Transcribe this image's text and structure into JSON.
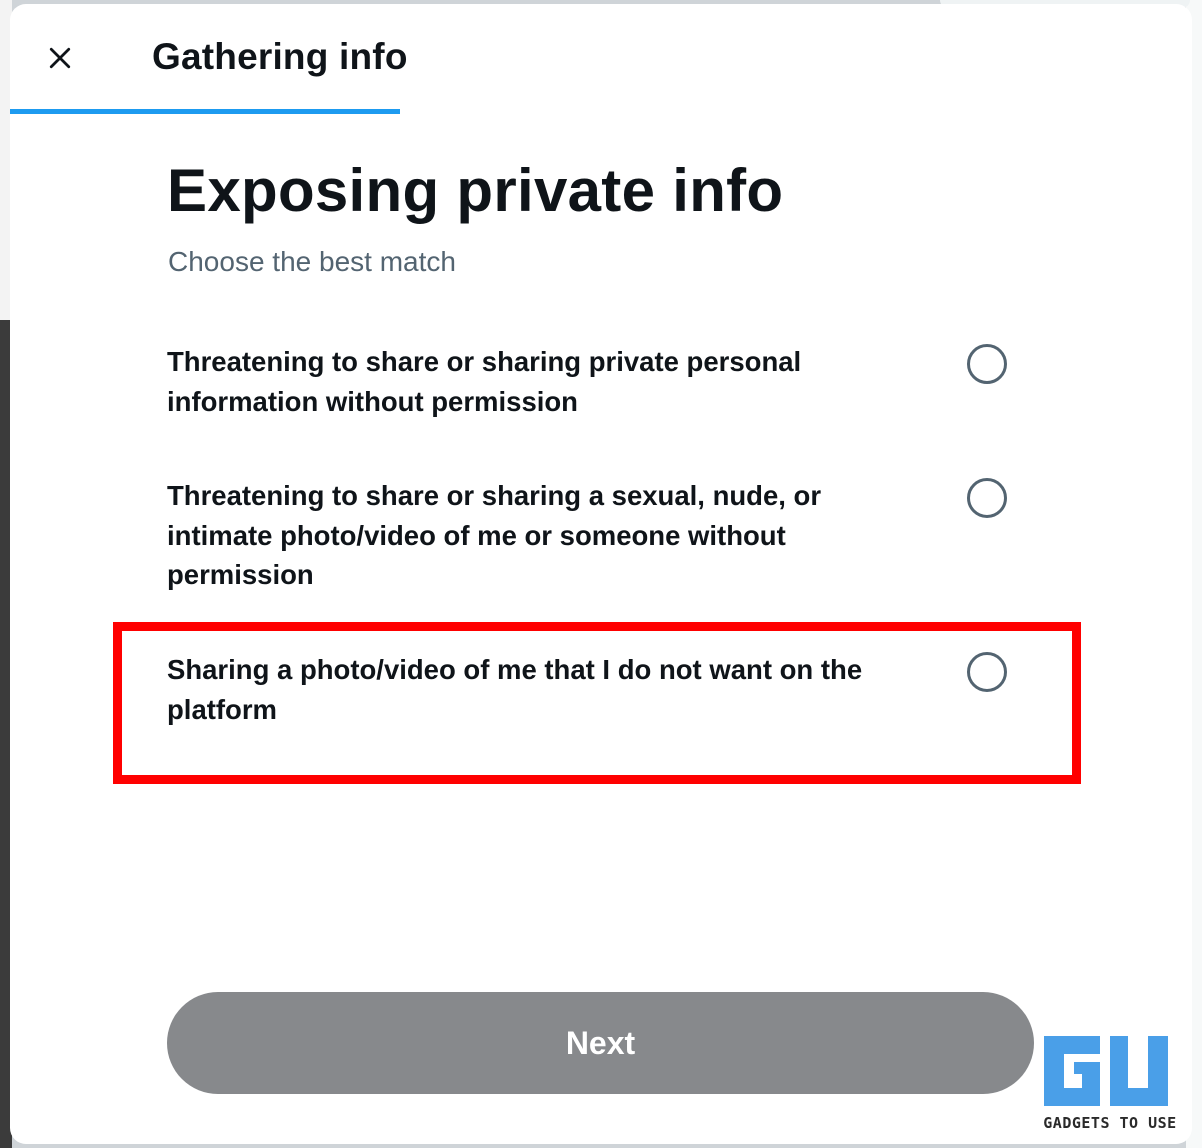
{
  "dialog": {
    "title": "Gathering info",
    "progress": 0.33
  },
  "main": {
    "heading": "Exposing private info",
    "subheading": "Choose the best match",
    "options": [
      {
        "label": "Threatening to share or sharing private personal information without permission",
        "selected": false
      },
      {
        "label": "Threatening to share or sharing a sexual, nude, or intimate photo/video of me or someone without permission",
        "selected": false
      },
      {
        "label": "Sharing a photo/video of me that I do not want on the platform",
        "selected": false,
        "highlighted": true
      }
    ]
  },
  "footer": {
    "next_label": "Next"
  },
  "watermark": {
    "logo_text": "GU",
    "caption": "GADGETS TO USE"
  },
  "colors": {
    "accent": "#1d9bf0",
    "highlight": "#ff0000",
    "button_disabled": "#87898c",
    "text_primary": "#0f1419",
    "text_secondary": "#536471",
    "logo_blue": "#4a9fe8"
  },
  "icons": {
    "close": "close-icon",
    "radio": "radio-unchecked-icon"
  }
}
